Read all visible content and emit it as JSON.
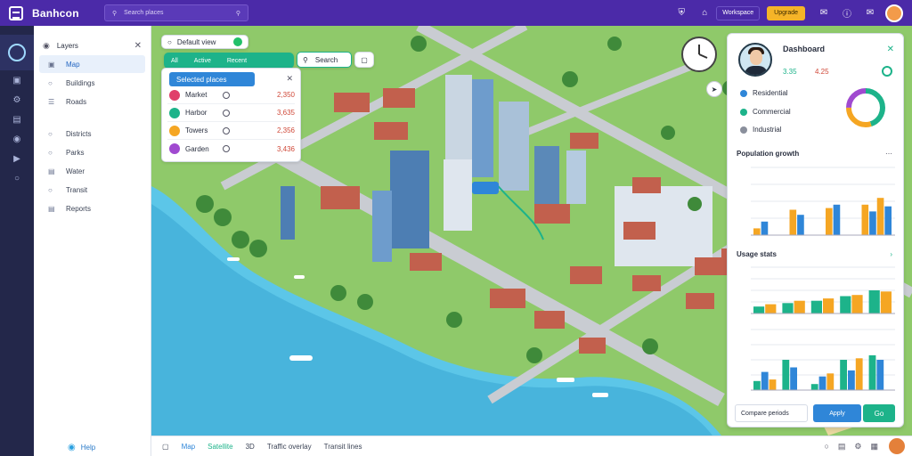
{
  "topbar": {
    "app_name": "Banhcon",
    "search_placeholder": "Search places",
    "chip_link": "Workspace",
    "chip_primary": "Upgrade",
    "icons": [
      "shield-icon",
      "home-icon",
      "bell-icon",
      "help-icon"
    ]
  },
  "sidepanel": {
    "header": "Layers",
    "items": [
      {
        "label": "Map",
        "icon": "map-icon",
        "active": true
      },
      {
        "label": "Buildings",
        "icon": "building-icon",
        "active": false
      },
      {
        "label": "Roads",
        "icon": "road-icon",
        "active": false
      },
      {
        "label": "Districts",
        "icon": "district-icon",
        "active": false
      },
      {
        "label": "Parks",
        "icon": "tree-icon",
        "active": false
      },
      {
        "label": "Water",
        "icon": "water-icon",
        "active": false
      },
      {
        "label": "Transit",
        "icon": "bus-icon",
        "active": false
      },
      {
        "label": "Reports",
        "icon": "report-icon",
        "active": false
      }
    ],
    "bottom_label": "Help"
  },
  "map": {
    "layer_chip": "Default view",
    "filter_tabs": [
      "All",
      "Active",
      "Recent"
    ],
    "search_placeholder": "Search",
    "list_selected": "Selected places",
    "list_rows": [
      {
        "name": "Market",
        "value": "2,350",
        "color": "#e0406a"
      },
      {
        "name": "Harbor",
        "value": "3,635",
        "color": "#1db38a"
      },
      {
        "name": "Towers",
        "value": "2,356",
        "color": "#f5a623"
      },
      {
        "name": "Garden",
        "value": "3,436",
        "color": "#a04ad0"
      }
    ]
  },
  "dashboard": {
    "name": "Dashboard",
    "stat_green": "3.35",
    "stat_red": "4.25",
    "legend": [
      {
        "label": "Residential",
        "color": "#2f86d8"
      },
      {
        "label": "Commercial",
        "color": "#1db38a"
      },
      {
        "label": "Industrial",
        "color": "#8a8f9c"
      }
    ],
    "donut": [
      {
        "value": 45,
        "color": "#1db38a"
      },
      {
        "value": 30,
        "color": "#f5a623"
      },
      {
        "value": 25,
        "color": "#a04ad0"
      }
    ],
    "section1_title": "Population growth",
    "section2_title": "Usage stats",
    "footer_label": "Compare periods",
    "btn_primary": "Apply",
    "btn_secondary": "Go"
  },
  "chart_data": [
    {
      "type": "bar",
      "title": "Population growth",
      "categories": [
        "",
        "",
        "",
        ""
      ],
      "ylim": [
        0,
        400
      ],
      "series": [
        {
          "values": [
            40,
            150,
            160,
            180
          ],
          "color": "#f5a623"
        },
        {
          "values": [
            80,
            120,
            180,
            140
          ],
          "color": "#2f86d8"
        },
        {
          "values": [
            0,
            0,
            0,
            220
          ],
          "color": "#f5a623"
        },
        {
          "values": [
            0,
            0,
            0,
            170
          ],
          "color": "#2f86d8"
        }
      ]
    },
    {
      "type": "bar",
      "title": "Usage stats",
      "categories": [
        "",
        "",
        "",
        "",
        ""
      ],
      "ylim": [
        0,
        400
      ],
      "series": [
        {
          "values": [
            60,
            90,
            110,
            150,
            200
          ],
          "color": "#1db38a"
        },
        {
          "values": [
            80,
            110,
            130,
            160,
            190
          ],
          "color": "#f5a623"
        }
      ]
    },
    {
      "type": "bar",
      "title": "",
      "categories": [
        "",
        "",
        "",
        "",
        ""
      ],
      "ylim": [
        0,
        400
      ],
      "series": [
        {
          "values": [
            60,
            200,
            40,
            200,
            230
          ],
          "color": "#1db38a"
        },
        {
          "values": [
            120,
            150,
            90,
            130,
            200
          ],
          "color": "#2f86d8"
        },
        {
          "values": [
            70,
            0,
            110,
            210,
            0
          ],
          "color": "#f5a623"
        }
      ]
    }
  ],
  "bottombar": {
    "items": [
      "Map",
      "Satellite",
      "3D",
      "Traffic overlay",
      "Transit lines"
    ],
    "icons": [
      "fullscreen-icon",
      "share-icon",
      "trash-icon",
      "settings-icon"
    ]
  }
}
